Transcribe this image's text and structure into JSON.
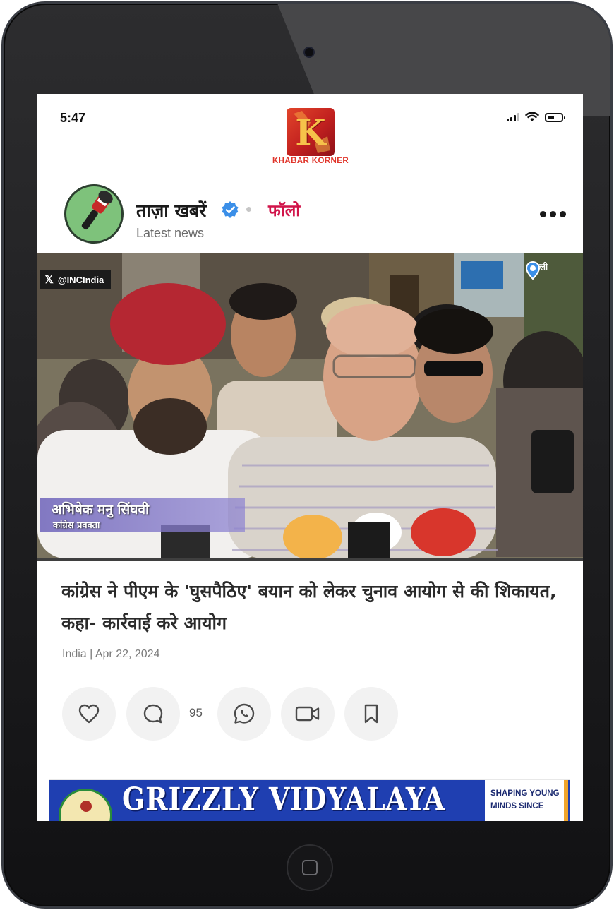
{
  "status_bar": {
    "time": "5:47"
  },
  "brand": {
    "logo_letter": "K",
    "name": "KHABAR KORNER"
  },
  "publisher": {
    "name": "ताज़ा खबरें",
    "subtitle": "Latest news",
    "follow_label": "फॉलो",
    "verified": true
  },
  "image": {
    "source_handle": "@INCIndia",
    "location": "दिल्ली",
    "lower_third_name": "अभिषेक मनु सिंघवी",
    "lower_third_role": "कांग्रेस प्रवक्ता"
  },
  "article": {
    "headline": "कांग्रेस ने पीएम के 'घुसपैठिए' बयान को लेकर चुनाव आयोग से की शिकायत, कहा- कार्रवाई करे आयोग",
    "meta": "India | Apr 22, 2024",
    "comment_count": "95"
  },
  "actions": {
    "like_icon": "heart-icon",
    "comment_icon": "comment-icon",
    "whatsapp_icon": "whatsapp-icon",
    "video_icon": "video-icon",
    "bookmark_icon": "bookmark-icon"
  },
  "ad": {
    "title": "GRIZZLY VIDYALAYA",
    "tagline": "SHAPING YOUNG MINDS SINCE"
  },
  "colors": {
    "follow": "#d1144a",
    "brand_red": "#e0342a",
    "verified_blue": "#3b8fe8",
    "ad_blue": "#1f3fb1"
  }
}
